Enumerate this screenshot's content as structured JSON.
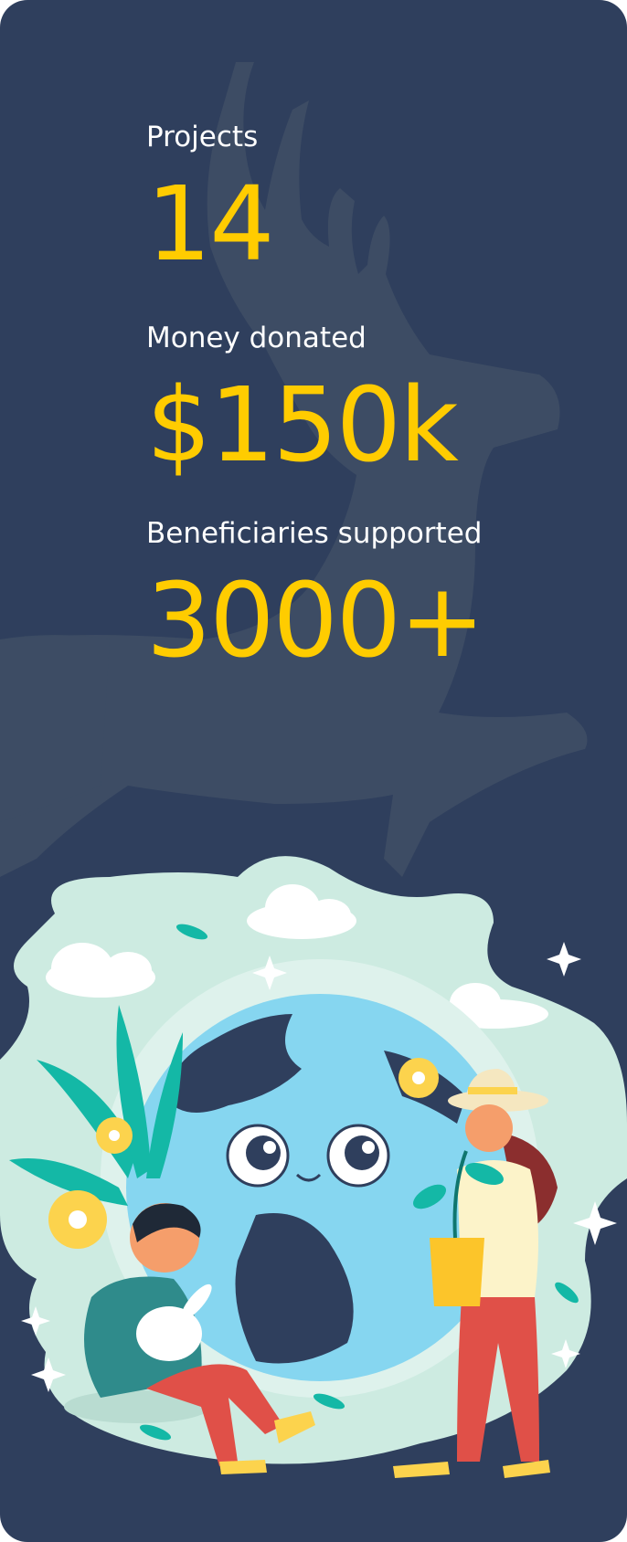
{
  "stats": [
    {
      "label": "Projects",
      "value": "14"
    },
    {
      "label": "Money donated",
      "value": "$150k"
    },
    {
      "label": "Beneficiaries supported",
      "value": "3000+"
    }
  ],
  "colors": {
    "background": "#2f3f5d",
    "accent": "#ffcc00",
    "text": "#ffffff",
    "globe": "#86d6f0",
    "land": "#cdebe1"
  },
  "illustration": {
    "icons": [
      "deer-silhouette",
      "globe-face",
      "boy-with-rabbit",
      "woman-with-plant",
      "flowers",
      "clouds",
      "sparkles"
    ]
  }
}
